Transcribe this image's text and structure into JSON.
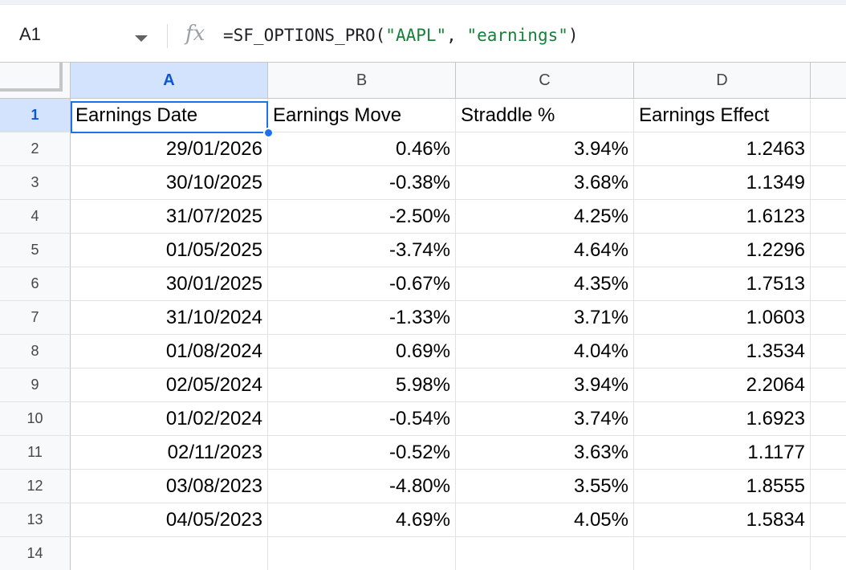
{
  "name_box": {
    "value": "A1"
  },
  "formula_bar": {
    "icon": "fx-icon",
    "prefix": "=SF_OPTIONS_PRO(",
    "arg1": "\"AAPL\"",
    "separator": ", ",
    "arg2": "\"earnings\"",
    "suffix": ")"
  },
  "columns": [
    "A",
    "B",
    "C",
    "D"
  ],
  "rows": [
    "1",
    "2",
    "3",
    "4",
    "5",
    "6",
    "7",
    "8",
    "9",
    "10",
    "11",
    "12",
    "13",
    "14"
  ],
  "selected_cell": "A1",
  "headers": [
    "Earnings Date",
    "Earnings Move",
    "Straddle %",
    "Earnings Effect"
  ],
  "data": [
    [
      "29/01/2026",
      "0.46%",
      "3.94%",
      "1.2463"
    ],
    [
      "30/10/2025",
      "-0.38%",
      "3.68%",
      "1.1349"
    ],
    [
      "31/07/2025",
      "-2.50%",
      "4.25%",
      "1.6123"
    ],
    [
      "01/05/2025",
      "-3.74%",
      "4.64%",
      "1.2296"
    ],
    [
      "30/01/2025",
      "-0.67%",
      "4.35%",
      "1.7513"
    ],
    [
      "31/10/2024",
      "-1.33%",
      "3.71%",
      "1.0603"
    ],
    [
      "01/08/2024",
      "0.69%",
      "4.04%",
      "1.3534"
    ],
    [
      "02/05/2024",
      "5.98%",
      "3.94%",
      "2.2064"
    ],
    [
      "01/02/2024",
      "-0.54%",
      "3.74%",
      "1.6923"
    ],
    [
      "02/11/2023",
      "-0.52%",
      "3.63%",
      "1.1177"
    ],
    [
      "03/08/2023",
      "-4.80%",
      "3.55%",
      "1.8555"
    ],
    [
      "04/05/2023",
      "4.69%",
      "4.05%",
      "1.5834"
    ],
    [
      "",
      "",
      "",
      ""
    ]
  ],
  "colors": {
    "selection": "#1a73e8",
    "header_selected_bg": "#d3e3fd",
    "header_selected_text": "#0b57d0",
    "formula_string": "#188038"
  }
}
